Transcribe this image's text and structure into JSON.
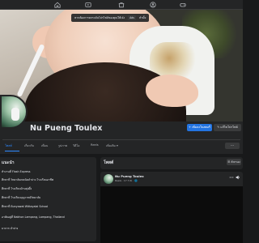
{
  "nav": {
    "icons": [
      "home-icon",
      "video-icon",
      "marketplace-icon",
      "groups-icon",
      "gaming-icon"
    ]
  },
  "cover": {
    "toast": {
      "text": "หากต้องการยกระดับโปรไฟล์ของคุณให้เจ๋ง",
      "button_label": "Ads",
      "link_label": "ทำมั้ย"
    }
  },
  "profile": {
    "name": "Nu Pueng Toulex",
    "primary_button": "+ เพิ่มลงในสตอรี่",
    "secondary_button": "✎ แก้ไขโปรไฟล์"
  },
  "tabs": [
    {
      "label": "โพสต์",
      "active": true
    },
    {
      "label": "เกี่ยวกับ",
      "active": false
    },
    {
      "label": "เพื่อน",
      "active": false
    },
    {
      "label": "รูปภาพ",
      "active": false
    },
    {
      "label": "วิดีโอ",
      "active": false
    },
    {
      "label": "Reels",
      "active": false
    },
    {
      "label": "เพิ่มเติม ▾",
      "active": false
    }
  ],
  "tab_more": "···",
  "intro": {
    "title": "แนะนำ",
    "items": [
      "ทำงานที่ Flash Express",
      "ศึกษาที่ วิทยาลัยเทคนิคลำปาง โรงเรียนอาชีพ",
      "ศึกษาที่ โรงเรียนบ้านทุ่งผึ้ง",
      "ศึกษาที่ โรงเรียนบุญวาทย์วิทยาลัย",
      "ศึกษาที่ Bunyawat Wittayalai School",
      "อาศัยอยู่ที่ Nakhon Lampang, Lampang, Thailand",
      "มาจาก ลำปาง"
    ]
  },
  "posts": {
    "title": "โพสต์",
    "filter_label": "☰ ตัวกรอง"
  },
  "post": {
    "author": "Nu Pueng Toulex",
    "meta": "Reels · 17 ก.พ. · 🌐"
  },
  "colors": {
    "background": "#18191a",
    "surface": "#242526",
    "accent": "#2374e1",
    "text": "#e4e6eb",
    "muted": "#b0b3b8"
  }
}
